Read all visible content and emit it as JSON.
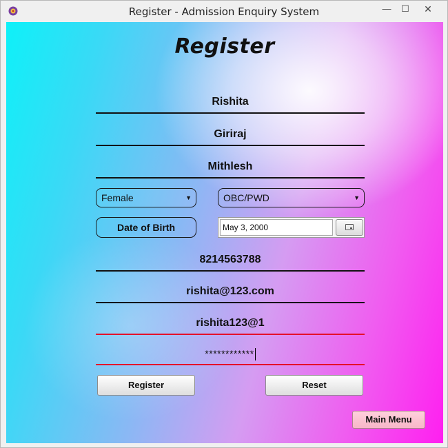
{
  "window": {
    "title": "Register - Admission Enquiry System",
    "controls": {
      "minimize": "—",
      "maximize": "☐",
      "close": "✕"
    }
  },
  "form": {
    "heading": "Register",
    "first_name": "Rishita",
    "middle_name": "Giriraj",
    "last_name": "Mithlesh",
    "gender": {
      "selected": "Female"
    },
    "category": {
      "selected": "OBC/PWD"
    },
    "dob_label": "Date of Birth",
    "dob_value": "May 3, 2000",
    "phone": "8214563788",
    "email": "rishita@123.com",
    "username": "rishita123@1",
    "password_masked": "************"
  },
  "buttons": {
    "register": "Register",
    "reset": "Reset",
    "main_menu": "Main Menu"
  }
}
